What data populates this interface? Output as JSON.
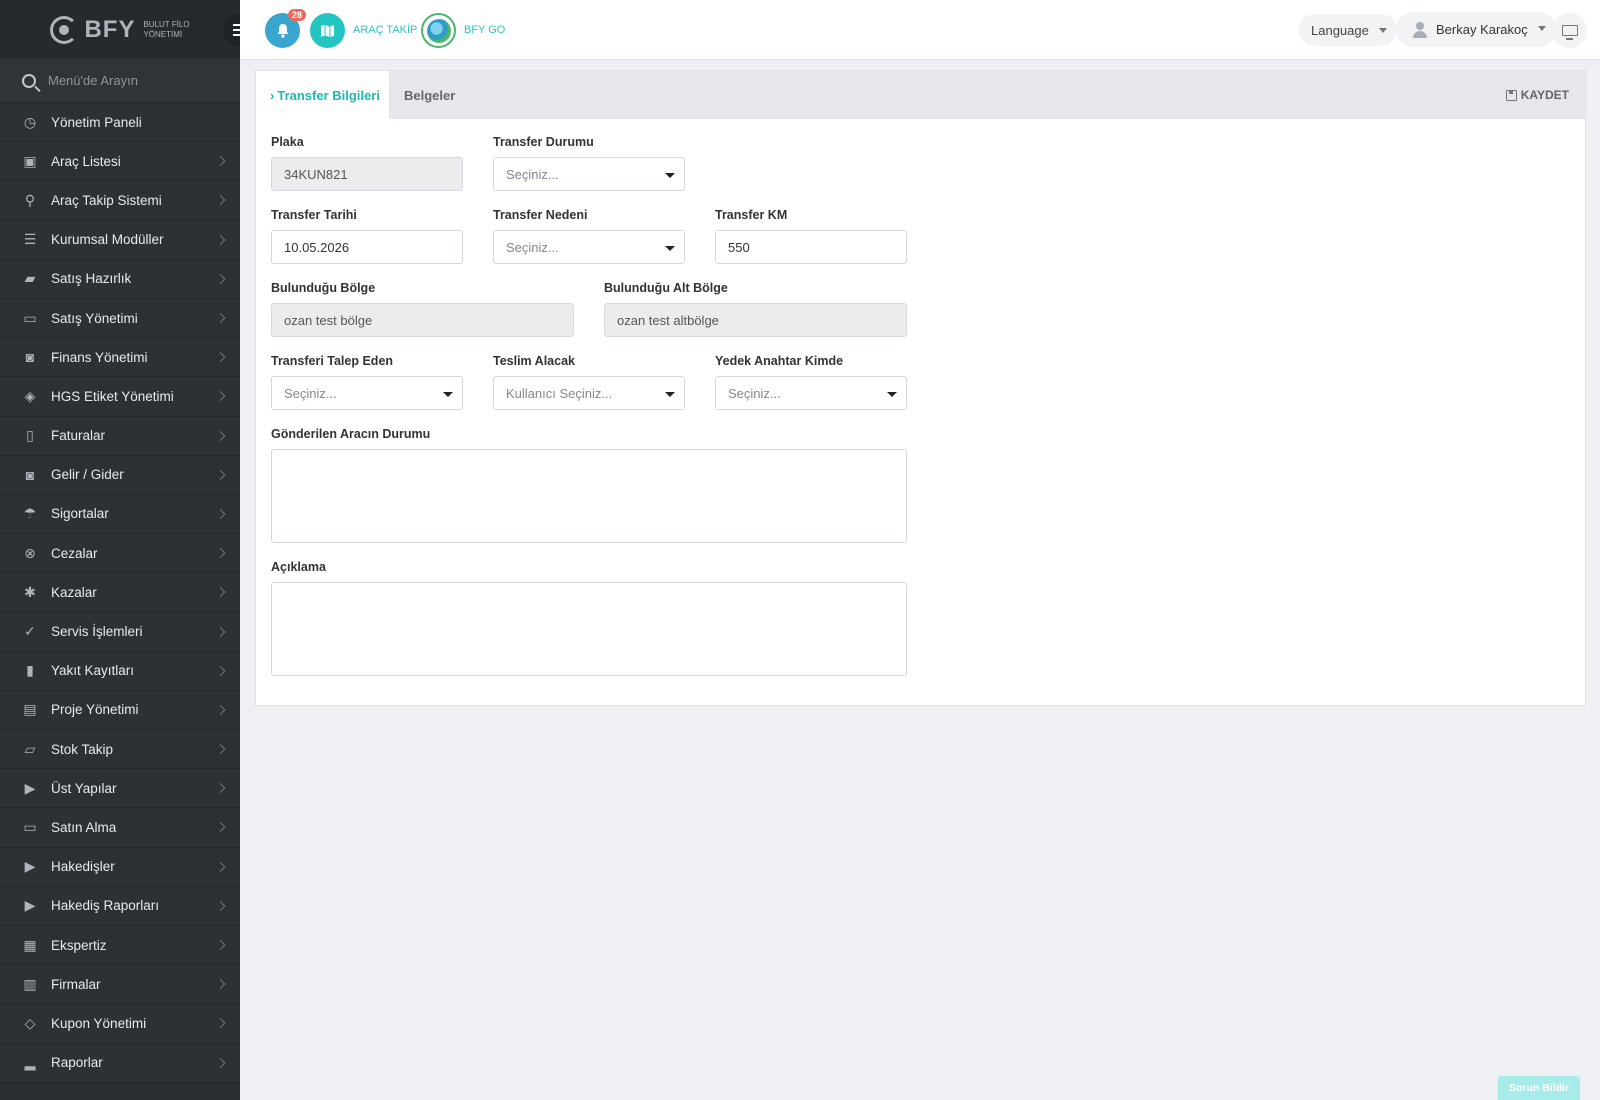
{
  "brand": {
    "name": "BFY",
    "tagline_line1": "BULUT FİLO",
    "tagline_line2": "YÖNETİMİ"
  },
  "sidebar": {
    "search_placeholder": "Menü'de Arayın",
    "items": [
      {
        "label": "Yönetim Paneli",
        "icon": "dashboard-icon",
        "chevron": false
      },
      {
        "label": "Araç Listesi",
        "icon": "bus-icon",
        "chevron": true
      },
      {
        "label": "Araç Takip Sistemi",
        "icon": "map-pin-icon",
        "chevron": true
      },
      {
        "label": "Kurumsal Modüller",
        "icon": "server-icon",
        "chevron": true
      },
      {
        "label": "Satış Hazırlık",
        "icon": "book-icon",
        "chevron": true
      },
      {
        "label": "Satış Yönetimi",
        "icon": "credit-card-icon",
        "chevron": true
      },
      {
        "label": "Finans Yönetimi",
        "icon": "money-icon",
        "chevron": true
      },
      {
        "label": "HGS Etiket Yönetimi",
        "icon": "tag-icon",
        "chevron": true
      },
      {
        "label": "Faturalar",
        "icon": "file-icon",
        "chevron": true
      },
      {
        "label": "Gelir / Gider",
        "icon": "money-icon",
        "chevron": true
      },
      {
        "label": "Sigortalar",
        "icon": "umbrella-icon",
        "chevron": true
      },
      {
        "label": "Cezalar",
        "icon": "x-circle-icon",
        "chevron": true
      },
      {
        "label": "Kazalar",
        "icon": "car-crash-icon",
        "chevron": true
      },
      {
        "label": "Servis İşlemleri",
        "icon": "check-circle-icon",
        "chevron": true
      },
      {
        "label": "Yakıt Kayıtları",
        "icon": "gas-pump-icon",
        "chevron": true
      },
      {
        "label": "Proje Yönetimi",
        "icon": "briefcase-icon",
        "chevron": true
      },
      {
        "label": "Stok Takip",
        "icon": "inbox-icon",
        "chevron": true
      },
      {
        "label": "Üst Yapılar",
        "icon": "truck-icon",
        "chevron": true
      },
      {
        "label": "Satın Alma",
        "icon": "credit-card-icon",
        "chevron": true
      },
      {
        "label": "Hakedişler",
        "icon": "truck-icon",
        "chevron": true
      },
      {
        "label": "Hakediş Raporları",
        "icon": "truck-icon",
        "chevron": true
      },
      {
        "label": "Ekspertiz",
        "icon": "list-alt-icon",
        "chevron": true
      },
      {
        "label": "Firmalar",
        "icon": "building-icon",
        "chevron": true
      },
      {
        "label": "Kupon Yönetimi",
        "icon": "ticket-icon",
        "chevron": true
      },
      {
        "label": "Raporlar",
        "icon": "bar-chart-icon",
        "chevron": true
      }
    ]
  },
  "header": {
    "notification_count": "28",
    "arac_takip_label": "ARAÇ TAKİP",
    "bfy_go_label": "BFY GO",
    "language_label": "Language",
    "user_name": "Berkay Karakoç"
  },
  "tabs": {
    "active_label": "Transfer Bilgileri",
    "second_label": "Belgeler",
    "save_label": "KAYDET"
  },
  "form": {
    "plaka": {
      "label": "Plaka",
      "value": "34KUN821"
    },
    "transfer_durumu": {
      "label": "Transfer Durumu",
      "value": "Seçiniz..."
    },
    "transfer_tarihi": {
      "label": "Transfer Tarihi",
      "value": "10.05.2026"
    },
    "transfer_nedeni": {
      "label": "Transfer Nedeni",
      "value": "Seçiniz..."
    },
    "transfer_km": {
      "label": "Transfer KM",
      "value": "550"
    },
    "bolge": {
      "label": "Bulunduğu Bölge",
      "value": "ozan test bölge"
    },
    "alt_bolge": {
      "label": "Bulunduğu Alt Bölge",
      "value": "ozan test altbölge"
    },
    "talep_eden": {
      "label": "Transferi Talep Eden",
      "value": "Seçiniz..."
    },
    "teslim_alacak": {
      "label": "Teslim Alacak",
      "value": "Kullanıcı Seçiniz..."
    },
    "yedek_anahtar": {
      "label": "Yedek Anahtar Kimde",
      "value": "Seçiniz..."
    },
    "arac_durumu": {
      "label": "Gönderilen Aracın Durumu",
      "value": ""
    },
    "aciklama": {
      "label": "Açıklama",
      "value": ""
    }
  },
  "report_button": "Sorun Bildir",
  "colors": {
    "accent": "#1fb9b2",
    "sidebar": "#2d3134",
    "badge": "#e86a5f"
  }
}
